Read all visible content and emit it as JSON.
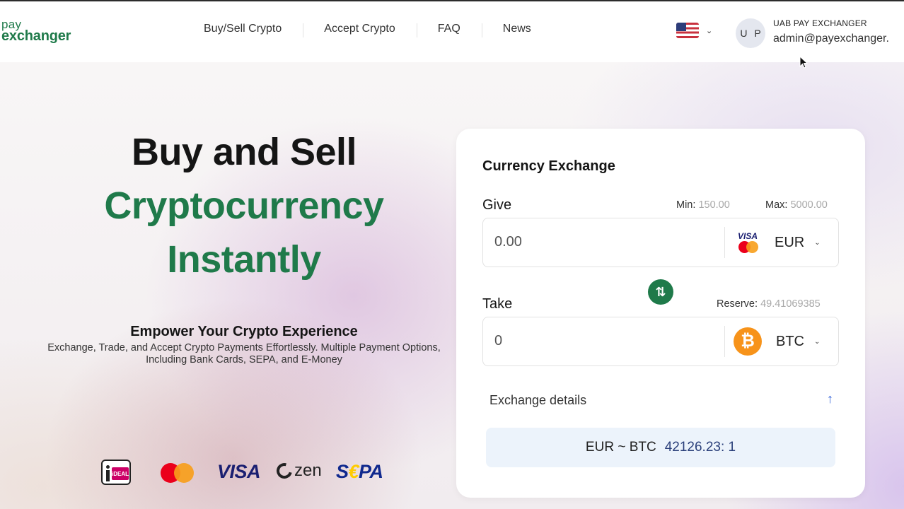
{
  "header": {
    "logo": {
      "line1": "pay",
      "line2": "exchanger"
    },
    "nav": [
      "Buy/Sell Crypto",
      "Accept Crypto",
      "FAQ",
      "News"
    ],
    "user": {
      "initials": "U P",
      "company": "UAB PAY EXCHANGER",
      "email": "admin@payexchanger."
    }
  },
  "hero": {
    "title_line1": "Buy and Sell",
    "title_line2": "Cryptocurrency",
    "title_line3": "Instantly",
    "tagline": "Empower Your Crypto Experience",
    "subtext": "Exchange, Trade, and Accept Crypto Payments Effortlessly. Multiple Payment Options, Including Bank Cards, SEPA, and E-Money",
    "payment_methods": {
      "ideal": "iDEAL",
      "visa": "VISA",
      "zen": "zen",
      "sepa_prefix": "S",
      "sepa_euro": "€",
      "sepa_suffix": "PA"
    }
  },
  "exchange": {
    "title": "Currency Exchange",
    "give": {
      "label": "Give",
      "min_label": "Min:",
      "min_value": "150.00",
      "max_label": "Max:",
      "max_value": "5000.00",
      "amount": "0.00",
      "currency": "EUR",
      "visa_text": "VISA"
    },
    "take": {
      "label": "Take",
      "reserve_label": "Reserve:",
      "reserve_value": "49.41069385",
      "amount": "0",
      "currency": "BTC",
      "btc_symbol": "₿"
    },
    "swap_icon": "⇅",
    "details_label": "Exchange details",
    "details_toggle": "↑",
    "rate": {
      "pair": "EUR ~ BTC",
      "value": "42126.23: 1"
    }
  },
  "colors": {
    "brand_green": "#1f7a4a",
    "link_blue": "#2a5bd7",
    "bitcoin_orange": "#f7931a"
  }
}
